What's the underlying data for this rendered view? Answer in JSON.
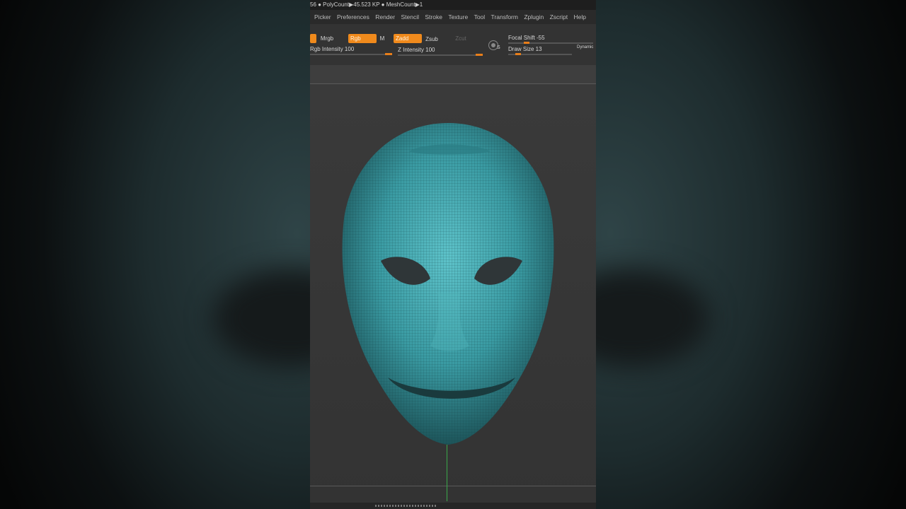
{
  "status_bar": {
    "text": "56 ● PolyCount▶45.523 KP ● MeshCount▶1"
  },
  "menu": {
    "items": [
      "Picker",
      "Preferences",
      "Render",
      "Stencil",
      "Stroke",
      "Texture",
      "Tool",
      "Transform",
      "Zplugin",
      "Zscript",
      "Help"
    ]
  },
  "toolbar": {
    "mrgb": "Mrgb",
    "rgb": "Rgb",
    "m": "M",
    "zadd": "Zadd",
    "zsub": "Zsub",
    "zcut": "Zcut",
    "rgb_intensity": "Rgb Intensity 100",
    "z_intensity": "Z Intensity 100",
    "focal_shift": "Focal Shift -55",
    "draw_size": "Draw Size 13",
    "dynamic": "Dynamic",
    "s_label": "S"
  },
  "colors": {
    "accent": "#f08a1c",
    "mesh": "#3fa4ab",
    "background": "#3b3b3b"
  },
  "icons": {
    "lightbox": "sphere-icon",
    "grip": "resize-grip-icon"
  }
}
